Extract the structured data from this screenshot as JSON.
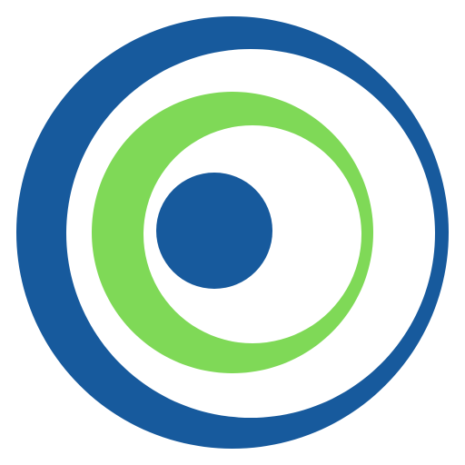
{
  "logo": {
    "icon_name": "concentric-circles-logo-icon",
    "colors": {
      "outer_ring": "#175a9d",
      "middle_ring": "#7fd957",
      "inner_dot": "#175a9d",
      "gap": "#ffffff",
      "background": "#ffffff"
    }
  }
}
